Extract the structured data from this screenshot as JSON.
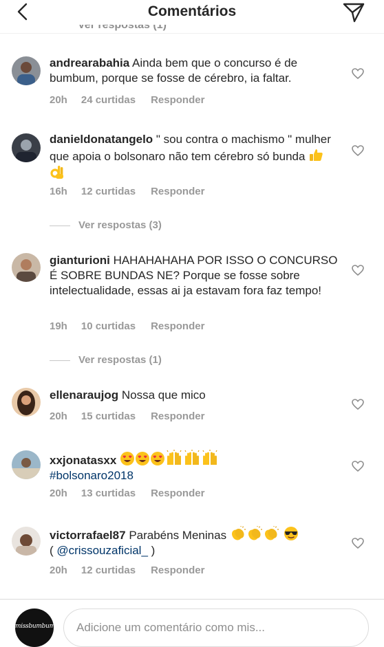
{
  "header": {
    "title": "Comentários",
    "cut_off_replies_label": "Ver respostas (1)"
  },
  "comments": [
    {
      "username": "andrearabahia",
      "text": "Ainda bem que o concurso é de bumbum, porque se fosse de cérebro, ia faltar.",
      "time": "20h",
      "likes": "24 curtidas",
      "reply_label": "Responder"
    },
    {
      "username": "danieldonatangelo",
      "text": "\" sou contra o machismo \" mulher que apoia o bolsonaro não tem cérebro só bunda",
      "emoji": [
        "thumbs-up",
        "ok-hand"
      ],
      "time": "16h",
      "likes": "12 curtidas",
      "reply_label": "Responder",
      "view_replies": "Ver respostas (3)"
    },
    {
      "username": "gianturioni",
      "text": "HAHAHAHAHA POR ISSO O CONCURSO É SOBRE BUNDAS NE? Porque se fosse sobre intelectualidade, essas ai ja estavam fora faz tempo!",
      "time": "19h",
      "likes": "10 curtidas",
      "reply_label": "Responder",
      "view_replies": "Ver respostas (1)"
    },
    {
      "username": "ellenaraujog",
      "text": "Nossa que mico",
      "time": "20h",
      "likes": "15 curtidas",
      "reply_label": "Responder"
    },
    {
      "username": "xxjonatasxx",
      "emoji": [
        "heart-eyes",
        "heart-eyes",
        "heart-eyes",
        "raised-hands",
        "raised-hands",
        "raised-hands"
      ],
      "hashtag": "#bolsonaro2018",
      "time": "20h",
      "likes": "13 curtidas",
      "reply_label": "Responder"
    },
    {
      "username": "victorrafael87",
      "text": "Parabéns Meninas",
      "emoji": [
        "clapping-hands",
        "clapping-hands",
        "clapping-hands",
        "sunglasses-face"
      ],
      "mention_prefix": "( ",
      "mention": "@crissouzaficial_",
      "mention_suffix": " )",
      "time": "20h",
      "likes": "12 curtidas",
      "reply_label": "Responder"
    }
  ],
  "composer": {
    "avatar_text": "missbumbum",
    "placeholder": "Adicione um comentário como mis..."
  },
  "colors": {
    "text": "#262626",
    "meta": "#999999",
    "link": "#003569",
    "divider": "#dbdbdb"
  }
}
